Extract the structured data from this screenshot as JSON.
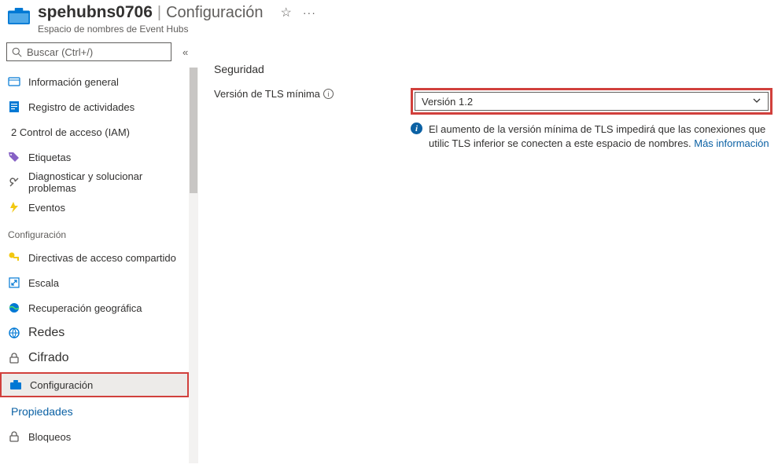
{
  "header": {
    "resource_name": "spehubns0706",
    "page_name": "Configuración",
    "resource_type": "Espacio de nombres de Event Hubs"
  },
  "sidebar": {
    "search_placeholder": "Buscar (Ctrl+/)",
    "items_top": [
      {
        "label": "Información general"
      },
      {
        "label": "Registro de actividades"
      },
      {
        "label": "2 Control de acceso (IAM)"
      },
      {
        "label": "Etiquetas"
      },
      {
        "label": "Diagnosticar y solucionar problemas"
      },
      {
        "label": "Eventos"
      }
    ],
    "group_header": "Configuración",
    "items_config": [
      {
        "label": "Directivas de acceso compartido"
      },
      {
        "label": "Escala"
      },
      {
        "label": "Recuperación geográfica"
      },
      {
        "label": "Redes"
      },
      {
        "label": "Cifrado"
      },
      {
        "label": "Configuración"
      },
      {
        "label": "Propiedades"
      },
      {
        "label": "Bloqueos"
      }
    ]
  },
  "main": {
    "section_title": "Seguridad",
    "tls_field_label": "Versión de TLS mínima",
    "tls_selected": "Versión 1.2",
    "tls_info_text": "El aumento de la versión mínima de TLS impedirá que las conexiones que utilic TLS inferior se conecten a este espacio de nombres. ",
    "tls_info_link": "Más información"
  }
}
